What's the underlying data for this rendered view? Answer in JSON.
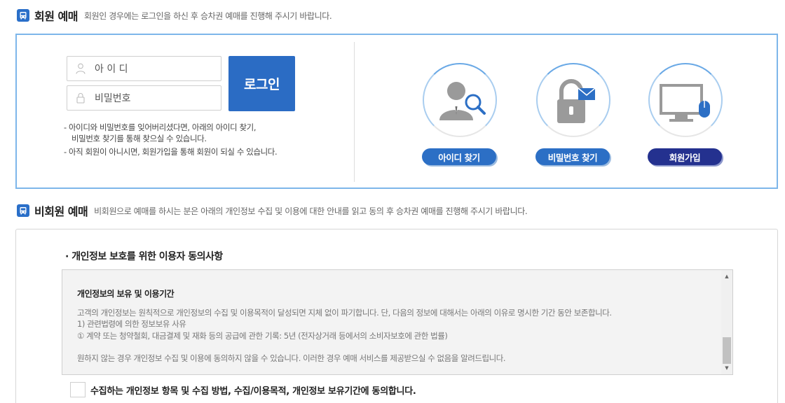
{
  "member_section": {
    "title": "회원 예매",
    "desc": "회원인 경우에는 로그인을 하신 후 승차권 예매를 진행해 주시기 바랍니다.",
    "id_placeholder": "아 이 디",
    "pw_placeholder": "비밀번호",
    "login_label": "로그인",
    "notes": [
      "- 아이디와 비밀번호를 잊어버리셨다면, 아래의 아이디 찾기,",
      "  비밀번호 찾기를 통해 찾으실 수 있습니다.",
      "- 아직 회원이 아니시면, 회원가입을 통해 회원이 되실 수 있습니다."
    ],
    "find_id_label": "아이디 찾기",
    "find_pw_label": "비밀번호 찾기",
    "signup_label": "회원가입"
  },
  "nonmember_section": {
    "title": "비회원 예매",
    "desc": "비회원으로 예매를 하시는 분은 아래의 개인정보 수집 및 이용에 대한 안내를 읽고 동의 후 승차권 예매를  진행해 주시기 바랍니다.",
    "consent_title": "· 개인정보 보호를 위한 이용자 동의사항",
    "terms": {
      "heading": "개인정보의 보유 및 이용기간",
      "lines": [
        "고객의 개인정보는 원칙적으로 개인정보의 수집 및 이용목적이 달성되면 지체 없이 파기합니다. 단, 다음의 정보에 대해서는 아래의 이유로 명시한 기간 동안 보존합니다.",
        "1) 관련법령에 의한 정보보유 사유",
        "① 계약 또는 청약철회, 대금결제 및 재화 등의 공급에 관한 기록: 5년 (전자상거래 등에서의 소비자보호에 관한 법률)"
      ],
      "footer": "원하지 않는 경우 개인정보 수집 및 이용에 동의하지 않을 수 있습니다. 이러한 경우 예매 서비스를 제공받으실 수 없음을 알려드립니다."
    },
    "agree_label": "수집하는 개인정보 항목 및 수집 방법, 수집/이용목적, 개인정보 보유기간에 동의합니다."
  },
  "colors": {
    "accent_blue": "#2b6cc4",
    "navy": "#24318f",
    "border_light_blue": "#7db6ea"
  },
  "icons": [
    "bus-icon",
    "user-icon",
    "lock-icon",
    "find-id-icon",
    "find-password-icon",
    "signup-monitor-icon",
    "scroll-up-icon",
    "scroll-down-icon"
  ]
}
